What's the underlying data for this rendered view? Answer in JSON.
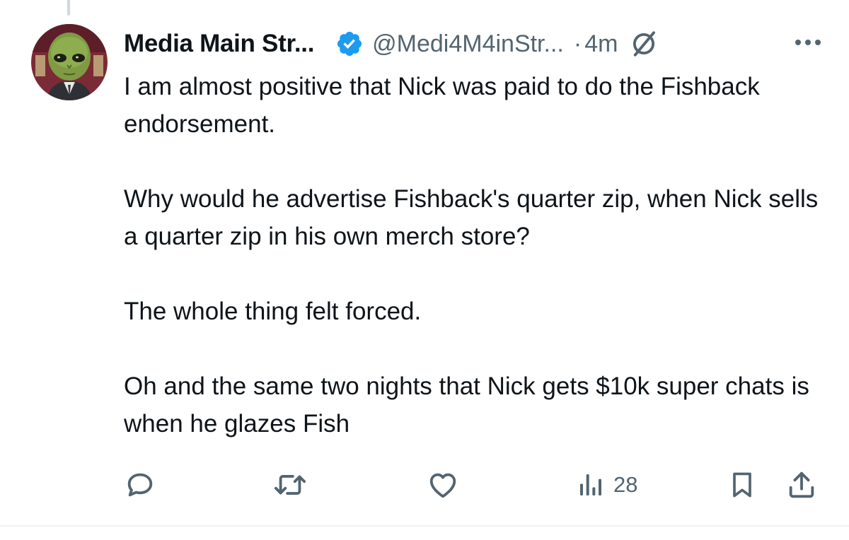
{
  "tweet": {
    "display_name": "Media Main Str...",
    "handle": "@Medi4M4inStr...",
    "separator": "·",
    "time": "4m",
    "paragraphs": [
      "I am almost positive that Nick was paid to do the Fishback endorsement.",
      "Why would he advertise Fishback's quarter zip, when Nick sells a quarter zip in his own merch store?",
      "The whole thing felt forced.",
      "Oh and the same two nights that Nick gets $10k super chats is when he glazes Fish"
    ],
    "views": "28"
  },
  "icons": {
    "verified": "verified-badge-icon",
    "grok": "grok-icon",
    "more": "more-icon",
    "reply": "reply-icon",
    "retweet": "retweet-icon",
    "like": "like-icon",
    "views": "views-icon",
    "bookmark": "bookmark-icon",
    "share": "share-icon"
  },
  "colors": {
    "text": "#0f1419",
    "secondary": "#536471",
    "verified": "#1d9bf0",
    "divider": "#eff3f4"
  }
}
